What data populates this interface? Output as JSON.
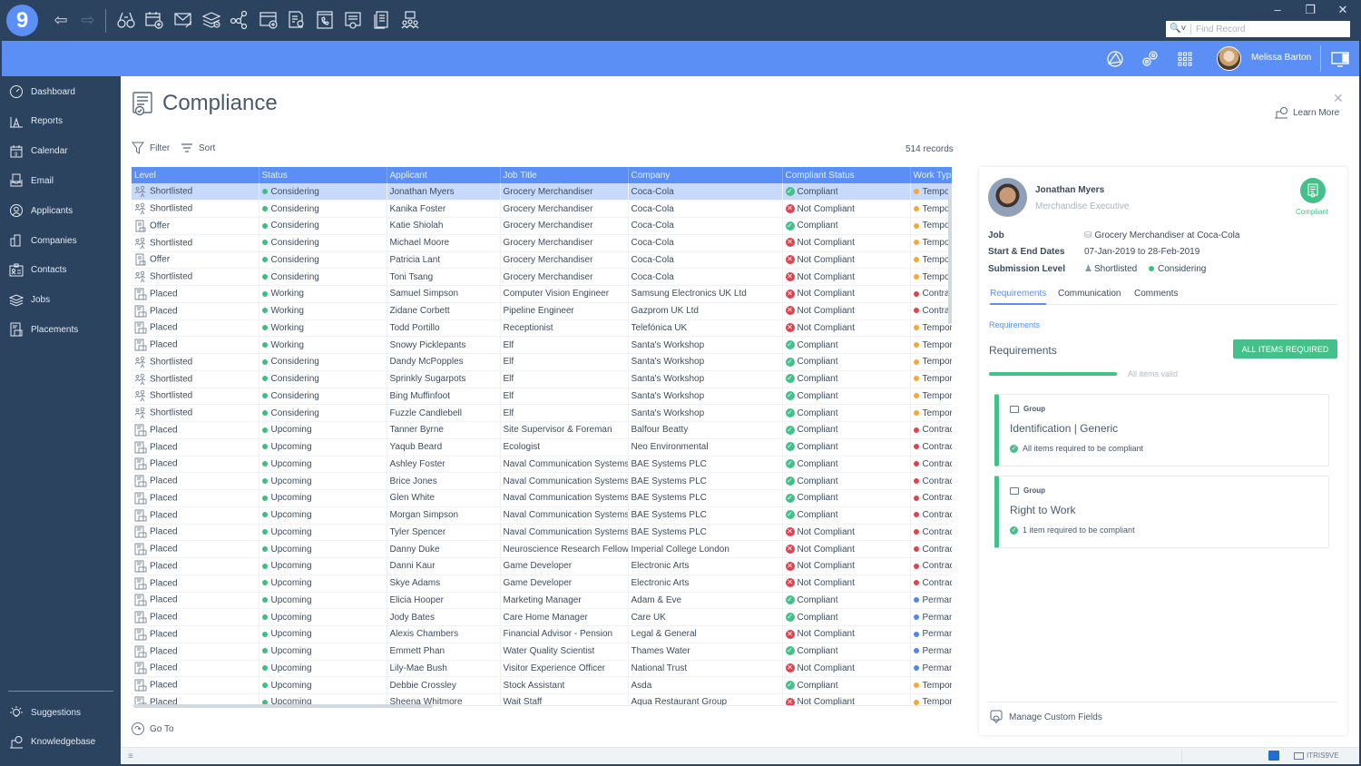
{
  "app": {
    "logo": "9",
    "find_placeholder": "Find Record",
    "user_name": "Melissa Barton",
    "toolbar_icons": [
      "search-binoculars-icon",
      "calendar-add-icon",
      "email-compose-icon",
      "jobs-remove-icon",
      "share-network-icon",
      "window-add-icon",
      "certificate-document-icon",
      "phone-log-icon",
      "document-approve-icon",
      "documents-icon",
      "team-meeting-icon"
    ]
  },
  "sidebar": {
    "items": [
      {
        "label": "Dashboard",
        "icon": "dashboard-gauge-icon"
      },
      {
        "label": "Reports",
        "icon": "reports-chart-icon"
      },
      {
        "label": "Calendar",
        "icon": "calendar-icon"
      },
      {
        "label": "Email",
        "icon": "email-inbox-icon"
      },
      {
        "label": "Applicants",
        "icon": "applicant-person-icon"
      },
      {
        "label": "Companies",
        "icon": "companies-building-icon"
      },
      {
        "label": "Contacts",
        "icon": "contacts-card-icon"
      },
      {
        "label": "Jobs",
        "icon": "jobs-stack-icon"
      },
      {
        "label": "Placements",
        "icon": "placements-document-icon"
      }
    ],
    "bottom": [
      {
        "label": "Suggestions",
        "icon": "lightbulb-icon"
      },
      {
        "label": "Knowledgebase",
        "icon": "knowledgebase-icon"
      }
    ]
  },
  "main": {
    "title": "Compliance",
    "filter_label": "Filter",
    "sort_label": "Sort",
    "records": "514 records",
    "goto_label": "Go To",
    "columns": [
      "Level",
      "Status",
      "Applicant",
      "Job Title",
      "Company",
      "Compliant Status",
      "Work Type"
    ],
    "rows": [
      {
        "level": "Shortlisted",
        "status": "Considering",
        "applicant": "Jonathan Myers",
        "job": "Grocery Merchandiser",
        "company": "Coca-Cola",
        "compliant": "Compliant",
        "work": "Temporary",
        "selected": true
      },
      {
        "level": "Shortlisted",
        "status": "Considering",
        "applicant": "Kanika Foster",
        "job": "Grocery Merchandiser",
        "company": "Coca-Cola",
        "compliant": "Not Compliant",
        "work": "Temporary"
      },
      {
        "level": "Offer",
        "status": "Considering",
        "applicant": "Katie Shiolah",
        "job": "Grocery Merchandiser",
        "company": "Coca-Cola",
        "compliant": "Compliant",
        "work": "Temporary"
      },
      {
        "level": "Shortlisted",
        "status": "Considering",
        "applicant": "Michael Moore",
        "job": "Grocery Merchandiser",
        "company": "Coca-Cola",
        "compliant": "Not Compliant",
        "work": "Temporary"
      },
      {
        "level": "Offer",
        "status": "Considering",
        "applicant": "Patricia Lant",
        "job": "Grocery Merchandiser",
        "company": "Coca-Cola",
        "compliant": "Not Compliant",
        "work": "Temporary"
      },
      {
        "level": "Shortlisted",
        "status": "Considering",
        "applicant": "Toni Tsang",
        "job": "Grocery Merchandiser",
        "company": "Coca-Cola",
        "compliant": "Not Compliant",
        "work": "Temporary"
      },
      {
        "level": "Placed",
        "status": "Working",
        "applicant": "Samuel Simpson",
        "job": "Computer Vision Engineer",
        "company": "Samsung Electronics UK Ltd",
        "compliant": "Not Compliant",
        "work": "Contract"
      },
      {
        "level": "Placed",
        "status": "Working",
        "applicant": "Zidane Corbett",
        "job": "Pipeline Engineer",
        "company": "Gazprom UK Ltd",
        "compliant": "Not Compliant",
        "work": "Contract"
      },
      {
        "level": "Placed",
        "status": "Working",
        "applicant": "Todd Portillo",
        "job": "Receptionist",
        "company": "Telefónica UK",
        "compliant": "Not Compliant",
        "work": "Temporary"
      },
      {
        "level": "Placed",
        "status": "Working",
        "applicant": "Snowy Picklepants",
        "job": "Elf",
        "company": "Santa's Workshop",
        "compliant": "Compliant",
        "work": "Temporary"
      },
      {
        "level": "Shortlisted",
        "status": "Considering",
        "applicant": "Dandy McPopples",
        "job": "Elf",
        "company": "Santa's Workshop",
        "compliant": "Compliant",
        "work": "Temporary"
      },
      {
        "level": "Shortlisted",
        "status": "Considering",
        "applicant": "Sprinkly Sugarpots",
        "job": "Elf",
        "company": "Santa's Workshop",
        "compliant": "Compliant",
        "work": "Temporary"
      },
      {
        "level": "Shortlisted",
        "status": "Considering",
        "applicant": "Bing Muffinfoot",
        "job": "Elf",
        "company": "Santa's Workshop",
        "compliant": "Compliant",
        "work": "Temporary"
      },
      {
        "level": "Shortlisted",
        "status": "Considering",
        "applicant": "Fuzzle Candlebell",
        "job": "Elf",
        "company": "Santa's Workshop",
        "compliant": "Compliant",
        "work": "Temporary"
      },
      {
        "level": "Placed",
        "status": "Upcoming",
        "applicant": "Tanner Byrne",
        "job": "Site Supervisor & Foreman",
        "company": "Balfour Beatty",
        "compliant": "Compliant",
        "work": "Contract"
      },
      {
        "level": "Placed",
        "status": "Upcoming",
        "applicant": "Yaqub Beard",
        "job": "Ecologist",
        "company": "Neo Environmental",
        "compliant": "Compliant",
        "work": "Contract"
      },
      {
        "level": "Placed",
        "status": "Upcoming",
        "applicant": "Ashley Foster",
        "job": "Naval Communication Systems",
        "company": "BAE Systems PLC",
        "compliant": "Compliant",
        "work": "Contract"
      },
      {
        "level": "Placed",
        "status": "Upcoming",
        "applicant": "Brice Jones",
        "job": "Naval Communication Systems",
        "company": "BAE Systems PLC",
        "compliant": "Compliant",
        "work": "Contract"
      },
      {
        "level": "Placed",
        "status": "Upcoming",
        "applicant": "Glen White",
        "job": "Naval Communication Systems",
        "company": "BAE Systems PLC",
        "compliant": "Compliant",
        "work": "Contract"
      },
      {
        "level": "Placed",
        "status": "Upcoming",
        "applicant": "Morgan Simpson",
        "job": "Naval Communication Systems",
        "company": "BAE Systems PLC",
        "compliant": "Compliant",
        "work": "Contract"
      },
      {
        "level": "Placed",
        "status": "Upcoming",
        "applicant": "Tyler Spencer",
        "job": "Naval Communication Systems",
        "company": "BAE Systems PLC",
        "compliant": "Not Compliant",
        "work": "Contract"
      },
      {
        "level": "Placed",
        "status": "Upcoming",
        "applicant": "Danny Duke",
        "job": "Neuroscience Research Fellow",
        "company": "Imperial College London",
        "compliant": "Not Compliant",
        "work": "Contract"
      },
      {
        "level": "Placed",
        "status": "Upcoming",
        "applicant": "Danni Kaur",
        "job": "Game Developer",
        "company": "Electronic Arts",
        "compliant": "Not Compliant",
        "work": "Contract"
      },
      {
        "level": "Placed",
        "status": "Upcoming",
        "applicant": "Skye Adams",
        "job": "Game Developer",
        "company": "Electronic Arts",
        "compliant": "Not Compliant",
        "work": "Contract"
      },
      {
        "level": "Placed",
        "status": "Upcoming",
        "applicant": "Elicia Hooper",
        "job": "Marketing Manager",
        "company": "Adam & Eve",
        "compliant": "Compliant",
        "work": "Permanent"
      },
      {
        "level": "Placed",
        "status": "Upcoming",
        "applicant": "Jody Bates",
        "job": "Care Home Manager",
        "company": "Care UK",
        "compliant": "Compliant",
        "work": "Permanent"
      },
      {
        "level": "Placed",
        "status": "Upcoming",
        "applicant": "Alexis Chambers",
        "job": "Financial Advisor - Pension",
        "company": "Legal & General",
        "compliant": "Not Compliant",
        "work": "Permanent"
      },
      {
        "level": "Placed",
        "status": "Upcoming",
        "applicant": "Emmett Phan",
        "job": "Water Quality Scientist",
        "company": "Thames Water",
        "compliant": "Compliant",
        "work": "Permanent"
      },
      {
        "level": "Placed",
        "status": "Upcoming",
        "applicant": "Lily-Mae Bush",
        "job": "Visitor Experience Officer",
        "company": "National Trust",
        "compliant": "Not Compliant",
        "work": "Permanent"
      },
      {
        "level": "Placed",
        "status": "Upcoming",
        "applicant": "Debbie Crossley",
        "job": "Stock Assistant",
        "company": "Asda",
        "compliant": "Compliant",
        "work": "Temporary"
      },
      {
        "level": "Placed",
        "status": "Upcoming",
        "applicant": "Sheena Whitmore",
        "job": "Wait Staff",
        "company": "Aqua Restaurant Group",
        "compliant": "Not Compliant",
        "work": "Temporary"
      }
    ]
  },
  "colors": {
    "accent": "#5b8ff5",
    "compliant": "#44c08a",
    "not_compliant": "#e0434f",
    "status_dot": "#3dbf7f",
    "temporary": "#f7a734",
    "contract": "#e0434f",
    "permanent": "#4f86ef"
  },
  "panel": {
    "learn_more": "Learn More",
    "name": "Jonathan Myers",
    "role": "Merchandise Executive",
    "badge_label": "Compliant",
    "job_label": "Job",
    "job_value": "Grocery Merchandiser  at Coca-Cola",
    "dates_label": "Start & End Dates",
    "dates_value": "07-Jan-2019 to 28-Feb-2019",
    "submission_label": "Submission Level",
    "submission_level": "Shortlisted",
    "submission_status": "Considering",
    "tabs": [
      "Requirements",
      "Communication",
      "Comments"
    ],
    "active_tab": "Requirements",
    "req_link": "Requirements",
    "req_title": "Requirements",
    "all_items_button": "ALL ITEMS REQUIRED",
    "progress_fraction": 1.0,
    "progress_label": "All items valid",
    "groups": [
      {
        "tag": "Group",
        "title": "Identification | Generic",
        "status": "All items required to be compliant"
      },
      {
        "tag": "Group",
        "title": "Right to Work",
        "status": "1 item required to be compliant"
      }
    ],
    "manage_custom_fields": "Manage Custom Fields"
  },
  "statusbar": {
    "menu_icon": "≡",
    "itris_label": "ITRIS9VE"
  }
}
